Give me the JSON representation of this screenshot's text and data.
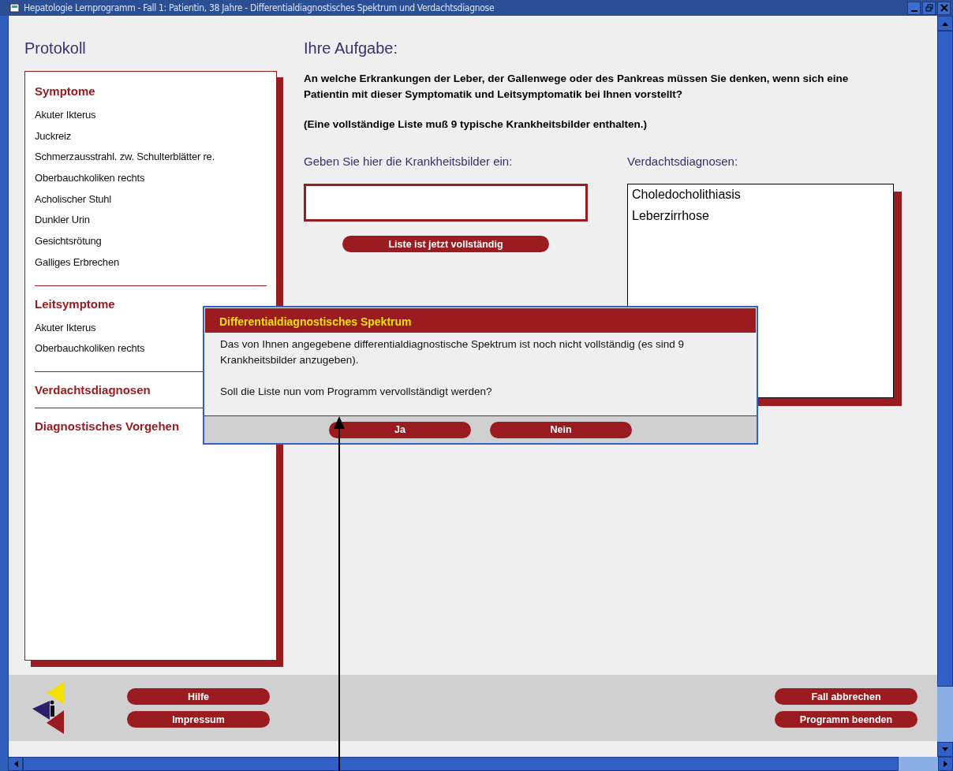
{
  "window": {
    "title": "Hepatologie Lernprogramm - Fall 1: Patientin, 38 Jahre - Differentialdiagnostisches Spektrum und Verdachtsdiagnose"
  },
  "protocol": {
    "heading": "Protokoll",
    "sections": [
      {
        "title": "Symptome",
        "items": [
          "Akuter Ikterus",
          "Juckreiz",
          "Schmerzausstrahl. zw. Schulterblätter re.",
          "Oberbauchkoliken rechts",
          "Acholischer Stuhl",
          "Dunkler Urin",
          "Gesichtsrötung",
          "Galliges Erbrechen"
        ]
      },
      {
        "title": "Leitsymptome",
        "items": [
          "Akuter Ikterus",
          "Oberbauchkoliken rechts"
        ]
      },
      {
        "title": "Verdachtsdiagnosen"
      },
      {
        "title": "Diagnostisches Vorgehen"
      }
    ]
  },
  "task": {
    "heading": "Ihre Aufgabe:",
    "question": "An welche Erkrankungen der Leber, der Gallenwege oder des Pankreas müssen Sie denken, wenn sich eine Patientin mit dieser Symptomatik und Leitsymptomatik bei Ihnen vorstellt?",
    "note": "(Eine vollständige Liste muß 9 typische Krankheitsbilder enthalten.)",
    "input_label": "Geben Sie hier die Krankheitsbilder ein:",
    "complete_button": "Liste ist jetzt vollständig",
    "suspicion_label": "Verdachtsdiagnosen:",
    "suspicions": [
      "Choledocholithiasis",
      "Leberzirrhose"
    ]
  },
  "dialog": {
    "title": "Differentialdiagnostisches Spektrum",
    "message": "Das von Ihnen angegebene differentialdiagnostische Spektrum ist noch nicht vollständig (es sind 9 Krankheitsbilder anzugeben).",
    "question": "Soll die Liste nun vom Programm vervollständigt werden?",
    "buttons": [
      "Ja",
      "Nein"
    ]
  },
  "footer": {
    "left_buttons": [
      "Hilfe",
      "Impressum"
    ],
    "right_buttons": [
      "Fall abbrechen",
      "Programm beenden"
    ]
  }
}
